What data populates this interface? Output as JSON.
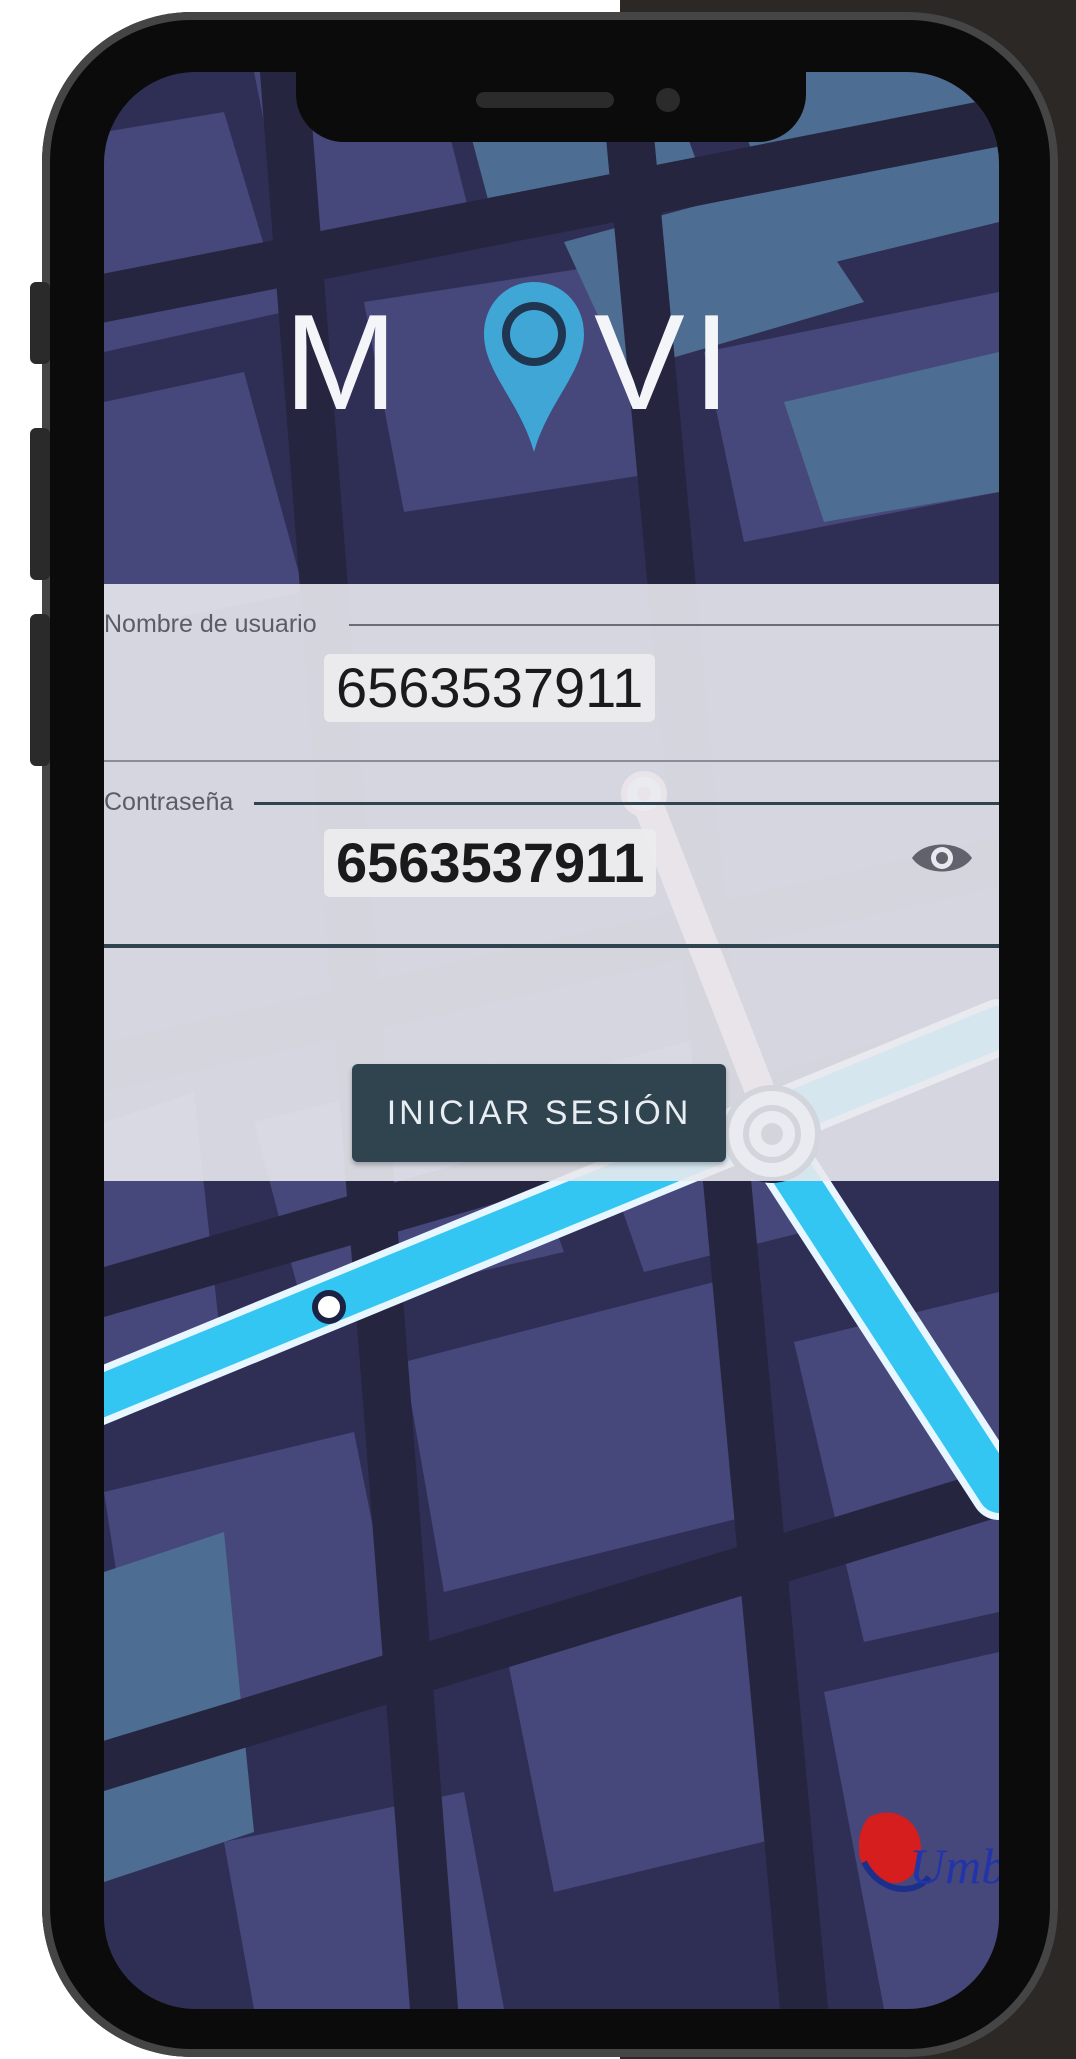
{
  "app": {
    "logo_letters": [
      "M",
      "VI"
    ],
    "brand_color": "#3fa6d6"
  },
  "login": {
    "username_label": "Nombre de usuario",
    "username_value": "6563537911",
    "password_label": "Contraseña",
    "password_value": "6563537911",
    "show_password_icon": "eye-icon",
    "submit_label": "INICIAR SESIÓN"
  },
  "footer": {
    "partner_logo_text": "Umb"
  },
  "colors": {
    "map_background": "#2f2f55",
    "route_blue": "#34c6f2",
    "route_pink": "#f4b3c4",
    "button_bg": "#304450"
  }
}
